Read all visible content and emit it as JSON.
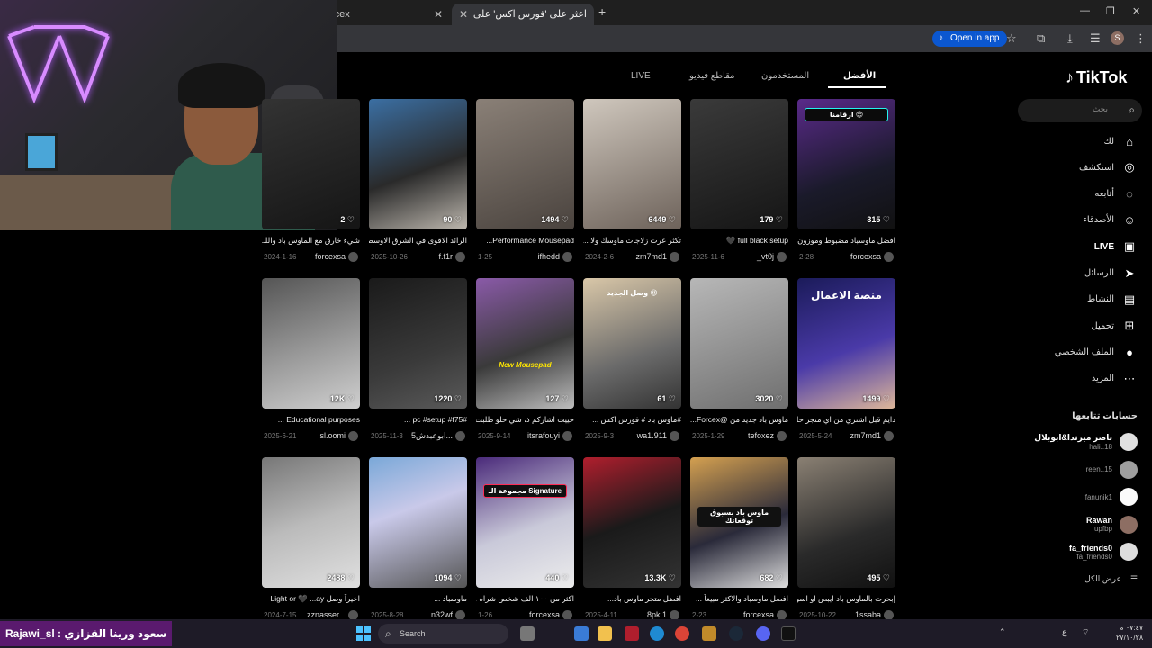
{
  "browser": {
    "tabs": [
      {
        "label": "rcex"
      },
      {
        "label": "اعثر على 'فورس اكس' على TikTok"
      }
    ],
    "open_in_app": "Open in app",
    "profile_initial": "S"
  },
  "tiktok": {
    "logo": "TikTok",
    "search_placeholder": "بحث",
    "nav": [
      {
        "label": "لك",
        "icon": "home-icon"
      },
      {
        "label": "استكشف",
        "icon": "compass-icon"
      },
      {
        "label": "أتابعه",
        "icon": "following-icon"
      },
      {
        "label": "الأصدقاء",
        "icon": "friends-icon"
      },
      {
        "label": "LIVE",
        "icon": "live-icon"
      },
      {
        "label": "الرسائل",
        "icon": "messages-icon"
      },
      {
        "label": "النشاط",
        "icon": "activity-icon"
      },
      {
        "label": "تحميل",
        "icon": "upload-icon"
      },
      {
        "label": "الملف الشخصي",
        "icon": "profile-icon"
      },
      {
        "label": "المزيد",
        "icon": "more-icon"
      }
    ],
    "following_title": "حسابات تتابعها",
    "following": [
      {
        "name": "ناصر ميرندا&ابوبلال",
        "handle": "hali..18"
      },
      {
        "name": "",
        "handle": "reen..15"
      },
      {
        "name": "",
        "handle": "fanunik1"
      },
      {
        "name": "Rawan",
        "handle": "upfbp"
      },
      {
        "name": "fa_friends0",
        "handle": "fa_friends0"
      }
    ],
    "see_all": "عرض الكل",
    "tabs": [
      "الأفضل",
      "المستخدمون",
      "مقاطع فيديو",
      "LIVE"
    ],
    "videos": [
      [
        {
          "likes": "315",
          "caption": "افضل ماوسباد مضبوط وموزون!",
          "date": "2-28",
          "user": "forcexsa",
          "tag": "ارقامنا 😍"
        },
        {
          "likes": "179",
          "caption": "full black setup 🖤",
          "date": "2025-11-6",
          "user": "_vt0j",
          "tag": ""
        },
        {
          "likes": "6449",
          "caption": "تكثر عرت زلاجات ماوسك ولا ...",
          "date": "2024-2-6",
          "user": "zm7md1",
          "tag": ""
        },
        {
          "likes": "1494",
          "caption": "Performance Mousepad...",
          "date": "1-25",
          "user": "ifhedd",
          "tag": ""
        },
        {
          "likes": "90",
          "caption": "الرائد الاقوى في الشرق الاوسط ...",
          "date": "2025-10-26",
          "user": "f.f1r",
          "tag": ""
        },
        {
          "likes": "2",
          "caption": "شيء خارق مع الماوس باد واللـ...",
          "date": "2024-1-16",
          "user": "forcexsa",
          "tag": ""
        }
      ],
      [
        {
          "likes": "1499",
          "caption": "دايم قبل اشتري من اي متجر حلـ...",
          "date": "2025-5-24",
          "user": "zm7md1",
          "tag": "منصة الاعمال"
        },
        {
          "likes": "3020",
          "caption": "ماوس باد جديد من @Forcex...",
          "date": "2025-1-29",
          "user": "tefoxez",
          "tag": ""
        },
        {
          "likes": "61",
          "caption": "#ماوس باد # فورس اكس ...",
          "date": "2025-9-3",
          "user": "wa1.911",
          "tag": "وصل الجديد 😍"
        },
        {
          "likes": "127",
          "caption": "حييت اشاركم ذ، شي حلو طلبت ه...",
          "date": "2025-9-14",
          "user": "itsrafouyi",
          "tag": "New Mousepad"
        },
        {
          "likes": "1220",
          "caption": "#pc #setup #f75 ...",
          "date": "2025-11-3",
          "user": "ابوعبدش5...",
          "tag": ""
        },
        {
          "likes": "12K",
          "caption": "Educational purposes ...",
          "date": "2025-6-21",
          "user": "sl.oomi",
          "tag": ""
        }
      ],
      [
        {
          "likes": "495",
          "caption": "إبحرت بالماوس باد ايبض او اسو...",
          "date": "2025-10-22",
          "user": "1ssaba",
          "tag": ""
        },
        {
          "likes": "682",
          "caption": "افضل ماوسباد والاكثر مبيعاً ...",
          "date": "2-23",
          "user": "forcexsa",
          "tag": "ماوس باد بسبوق توقعاتك"
        },
        {
          "likes": "13.3K",
          "caption": "افضل متجر ماوس باد...",
          "date": "2025-4-11",
          "user": "8pk.1",
          "tag": ""
        },
        {
          "likes": "440",
          "caption": "اكثر من ١٠٠ الف شخص شراه ...",
          "date": "1-26",
          "user": "forcexsa",
          "tag": "مجموعة الـ Signature"
        },
        {
          "likes": "1094",
          "caption": "ماوسباد ...",
          "date": "2025-8-28",
          "user": "n32wf",
          "tag": ""
        },
        {
          "likes": "2488",
          "caption": "اخيراً وصل Light or 🖤 ...ay",
          "date": "2024-7-15",
          "user": "zznasser...",
          "tag": ""
        }
      ]
    ]
  },
  "stream_overlay": {
    "text": "سعود ورينا القزازي : Rajawi_sl"
  },
  "taskbar": {
    "search": "Search",
    "lang": "ع",
    "time": "٠٧:٤٧ م",
    "date": "٢٧/١٠/٢٨"
  }
}
